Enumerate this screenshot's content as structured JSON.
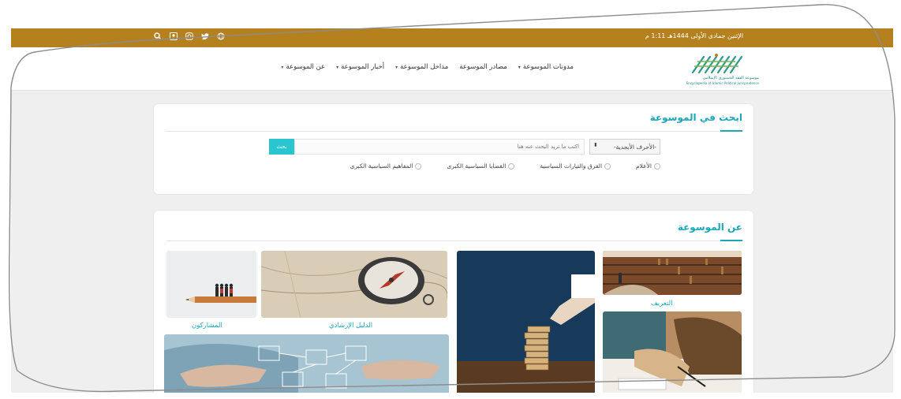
{
  "topbar": {
    "date_text": "الإثنين جمادى الأولى 1444هـ 1:11 م",
    "icons": [
      "search-icon",
      "user-icon",
      "instagram-icon",
      "twitter-icon",
      "globe-icon"
    ]
  },
  "logo": {
    "line1": "موسوعة الفقه الدستوري الإسلامي",
    "line2": "Encyclopedia of Islamic Political Jurisprudence"
  },
  "nav": {
    "items": [
      {
        "label": "عن الموسوعة",
        "has_caret": true
      },
      {
        "label": "أخبار الموسوعة",
        "has_caret": true
      },
      {
        "label": "مداخل الموسوعة",
        "has_caret": true
      },
      {
        "label": "مصادر الموسوعة",
        "has_caret": false
      },
      {
        "label": "مدونات الموسوعة",
        "has_caret": true
      }
    ]
  },
  "search": {
    "title": "ابحث في الموسوعة",
    "letters_select": "-الأحرف الأبجدية-",
    "input_placeholder": "اكتب ما تريد البحث عنه هنا",
    "button_label": "بحث",
    "filters": [
      {
        "label": "المفاهيم السياسية الكبرى"
      },
      {
        "label": "القضايا السياسية الكبرى"
      },
      {
        "label": "الفرق والتيارات السياسية"
      },
      {
        "label": "الأعلام"
      }
    ]
  },
  "about": {
    "title": "عن الموسوعة",
    "tiles": [
      {
        "label": "التعريف",
        "image": "library-photo"
      },
      {
        "label": "",
        "image": "blocks-tower-photo"
      },
      {
        "label": "الدليل الإرشادي",
        "image": "compass-map-photo"
      },
      {
        "label": "المشاركون",
        "image": "figures-on-pencil-photo"
      },
      {
        "label": "",
        "image": "writing-desk-photo"
      },
      {
        "label": "",
        "image": "network-hands-photo"
      }
    ]
  },
  "colors": {
    "topbar": "#b5811f",
    "accent": "#1aa7b8",
    "button": "#29c6cf"
  }
}
